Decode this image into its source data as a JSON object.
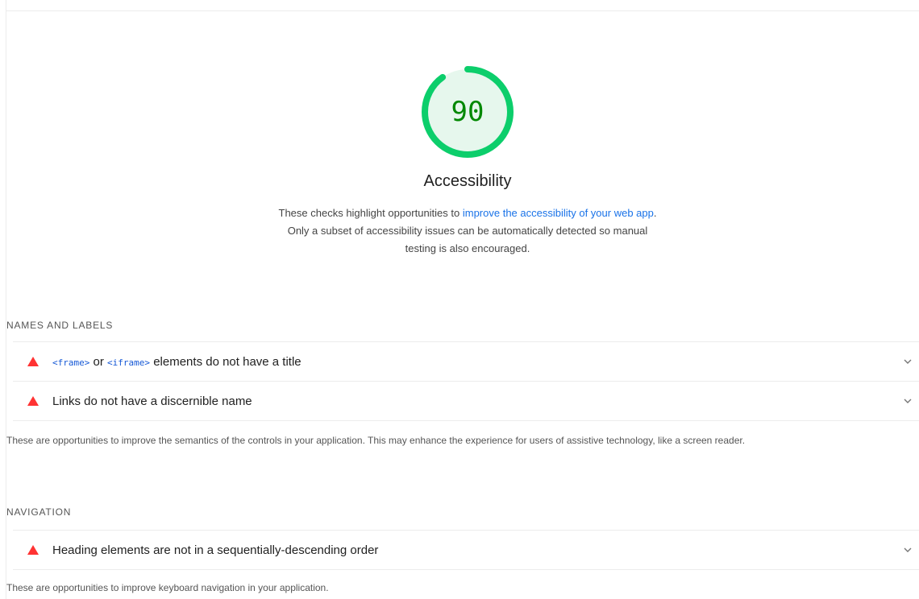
{
  "gauge": {
    "score": "90",
    "value": 0.9,
    "arc_color": "#0cce6b",
    "fill_color": "#e6f7ed",
    "text_color": "#008800"
  },
  "category": {
    "title": "Accessibility",
    "description_pre": "These checks highlight opportunities to ",
    "description_link": "improve the accessibility of your web app",
    "description_post": ". Only a subset of accessibility issues can be automatically detected so manual testing is also encouraged."
  },
  "groups": [
    {
      "title": "NAMES AND LABELS",
      "audits": [
        {
          "code1": "<frame>",
          "connector": " or ",
          "code2": "<iframe>",
          "rest": " elements do not have a title",
          "status_icon": "fail-triangle-icon",
          "expand_icon": "chevron-down-icon"
        },
        {
          "title": "Links do not have a discernible name",
          "status_icon": "fail-triangle-icon",
          "expand_icon": "chevron-down-icon"
        }
      ],
      "description": "These are opportunities to improve the semantics of the controls in your application. This may enhance the experience for users of assistive technology, like a screen reader."
    },
    {
      "title": "NAVIGATION",
      "audits": [
        {
          "title": "Heading elements are not in a sequentially-descending order",
          "status_icon": "fail-triangle-icon",
          "expand_icon": "chevron-down-icon"
        }
      ],
      "description": "These are opportunities to improve keyboard navigation in your application."
    }
  ],
  "colors": {
    "fail": "#ff3333",
    "link": "#1a73e8",
    "code": "#1558d6",
    "divider": "#ececec"
  }
}
